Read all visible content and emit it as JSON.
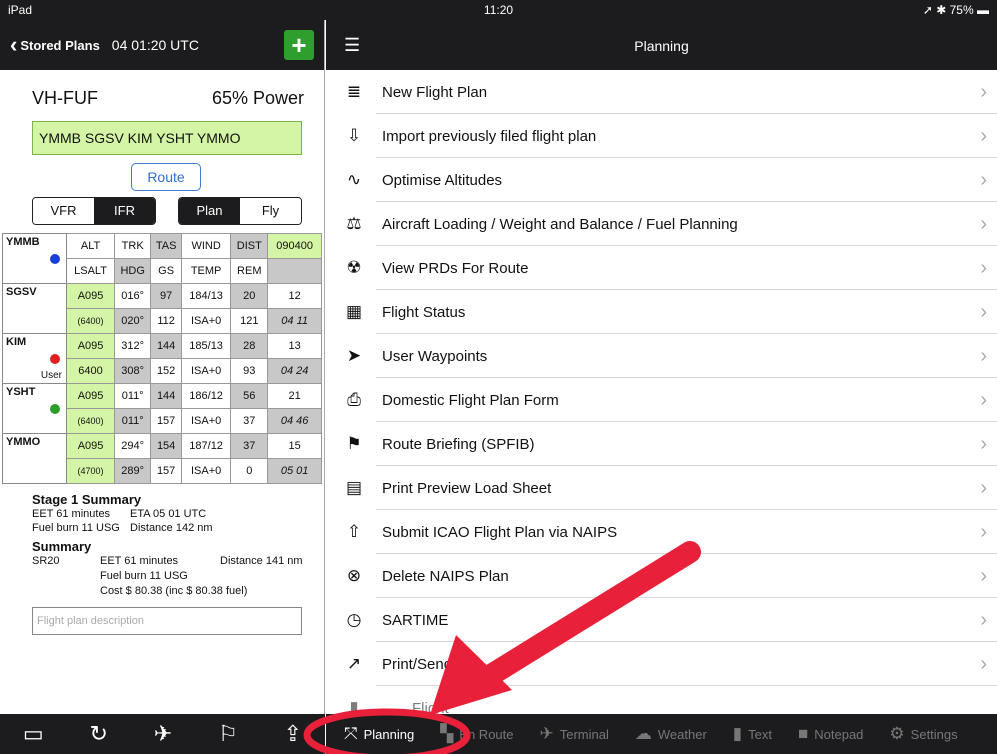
{
  "status": {
    "device": "iPad",
    "time": "11:20",
    "battery": "75%"
  },
  "left_nav": {
    "back_label": "Stored Plans",
    "time": "04 01:20 UTC",
    "add_label": "+"
  },
  "aircraft": {
    "reg": "VH-FUF",
    "power": "65% Power"
  },
  "route": {
    "text": "YMMB SGSV KIM  YSHT YMMO",
    "button": "Route"
  },
  "segments": {
    "rules": [
      "VFR",
      "IFR"
    ],
    "mode": [
      "Plan",
      "Fly"
    ]
  },
  "nav_log": {
    "origin": {
      "name": "YMMB",
      "h1": [
        "ALT",
        "TRK",
        "TAS",
        "WIND",
        "DIST",
        "090400"
      ],
      "h2": [
        "LSALT",
        "HDG",
        "GS",
        "TEMP",
        "REM",
        ""
      ]
    },
    "legs": [
      {
        "name": "SGSV",
        "user": "",
        "r1": [
          "A095",
          "016°",
          "97",
          "184/13",
          "20",
          "12"
        ],
        "r2": [
          "(6400)",
          "020°",
          "112",
          "ISA+0",
          "121",
          "04 11"
        ]
      },
      {
        "name": "KIM",
        "user": "User",
        "r1": [
          "A095",
          "312°",
          "144",
          "185/13",
          "28",
          "13"
        ],
        "r2": [
          "6400",
          "308°",
          "152",
          "ISA+0",
          "93",
          "04 24"
        ]
      },
      {
        "name": "YSHT",
        "user": "",
        "r1": [
          "A095",
          "011°",
          "144",
          "186/12",
          "56",
          "21"
        ],
        "r2": [
          "(6400)",
          "011°",
          "157",
          "ISA+0",
          "37",
          "04 46"
        ]
      },
      {
        "name": "YMMO",
        "user": "",
        "r1": [
          "A095",
          "294°",
          "154",
          "187/12",
          "37",
          "15"
        ],
        "r2": [
          "(4700)",
          "289°",
          "157",
          "ISA+0",
          "0",
          "05 01"
        ]
      }
    ]
  },
  "stage_summary": {
    "title": "Stage 1 Summary",
    "eet": "EET 61 minutes",
    "eta": "ETA 05 01 UTC",
    "fuel": "Fuel burn 11 USG",
    "distance": "Distance 142 nm"
  },
  "summary": {
    "title": "Summary",
    "aircraft": "SR20",
    "eet": "EET 61 minutes",
    "distance": "Distance 141 nm",
    "fuel": "Fuel burn 11 USG",
    "cost": "Cost $ 80.38 (inc $ 80.38 fuel)"
  },
  "description_placeholder": "Flight plan description",
  "planning": {
    "title": "Planning",
    "items": [
      {
        "label": "New Flight Plan",
        "icon": "new-plan-icon"
      },
      {
        "label": "Import previously filed flight plan",
        "icon": "import-icon"
      },
      {
        "label": "Optimise Altitudes",
        "icon": "optimise-icon"
      },
      {
        "label": "Aircraft Loading / Weight and Balance / Fuel Planning",
        "icon": "scales-icon"
      },
      {
        "label": "View PRDs For Route",
        "icon": "radiation-icon"
      },
      {
        "label": "Flight Status",
        "icon": "status-icon"
      },
      {
        "label": "User Waypoints",
        "icon": "location-arrow-icon"
      },
      {
        "label": "Domestic Flight Plan Form",
        "icon": "printer-icon"
      },
      {
        "label": "Route Briefing (SPFIB)",
        "icon": "flag-icon"
      },
      {
        "label": "Print Preview Load Sheet",
        "icon": "document-icon"
      },
      {
        "label": "Submit ICAO Flight Plan via NAIPS",
        "icon": "submit-icon"
      },
      {
        "label": "Delete NAIPS Plan",
        "icon": "delete-icon"
      },
      {
        "label": "SARTIME",
        "icon": "clock-icon"
      },
      {
        "label": "Print/Send",
        "icon": "share-icon"
      },
      {
        "label": "Flight",
        "icon": "book-icon"
      }
    ]
  },
  "tabs": [
    "Planning",
    "En Route",
    "Terminal",
    "Weather",
    "Text",
    "Notepad",
    "Settings"
  ]
}
